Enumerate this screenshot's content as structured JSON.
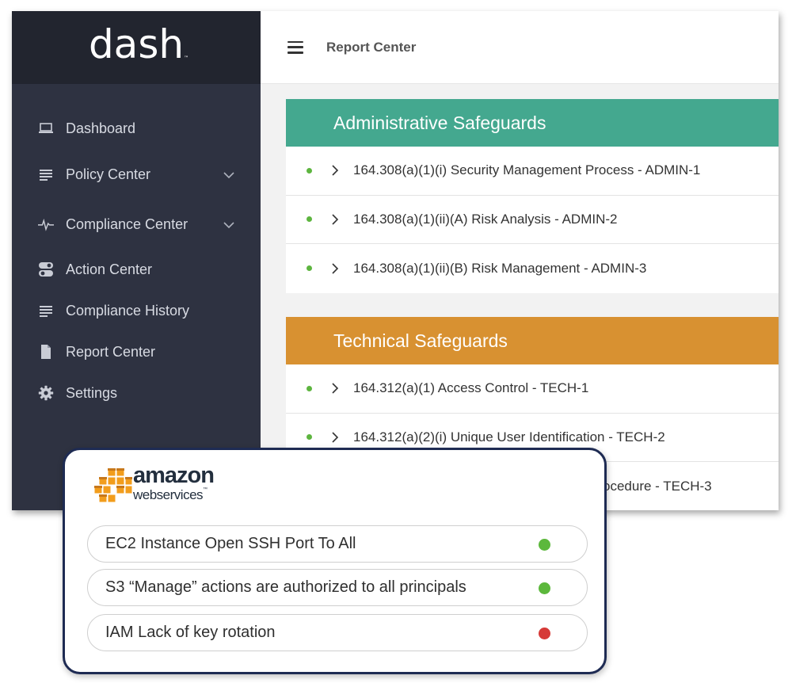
{
  "app": {
    "logo": "dash",
    "logo_tm": "™"
  },
  "sidebar": {
    "items": [
      {
        "label": "Dashboard",
        "icon": "laptop-icon"
      },
      {
        "label": "Policy Center",
        "icon": "list-icon",
        "expandable": true
      },
      {
        "label": "Compliance Center",
        "icon": "pulse-icon",
        "expandable": true
      },
      {
        "label": "Action Center",
        "icon": "toggle-icon"
      },
      {
        "label": "Compliance History",
        "icon": "list-icon"
      },
      {
        "label": "Report Center",
        "icon": "document-icon"
      },
      {
        "label": "Settings",
        "icon": "gear-icon"
      }
    ]
  },
  "header": {
    "title": "Report Center"
  },
  "sections": [
    {
      "title": "Administrative Safeguards",
      "color": "#44a88f",
      "rows": [
        "164.308(a)(1)(i) Security Management Process - ADMIN-1",
        "164.308(a)(1)(ii)(A) Risk Analysis - ADMIN-2",
        "164.308(a)(1)(ii)(B) Risk Management - ADMIN-3"
      ]
    },
    {
      "title": "Technical Safeguards",
      "color": "#d89131",
      "rows": [
        "164.312(a)(1) Access Control - TECH-1",
        "164.312(a)(2)(i) Unique User Identification - TECH-2",
        "ocedure - TECH-3"
      ]
    }
  ],
  "aws": {
    "logo_word": "amazon",
    "logo_sub": "webservices",
    "logo_tm": "™",
    "checks": [
      {
        "label": "EC2 Instance Open SSH Port To All",
        "status_color": "#5cb83c"
      },
      {
        "label": "S3 “Manage” actions are authorized to all principals",
        "status_color": "#5cb83c"
      },
      {
        "label": "IAM Lack of key rotation",
        "status_color": "#d63a37"
      }
    ]
  },
  "colors": {
    "sidebar_bg": "#2e3241",
    "logo_bg": "#22252f",
    "status_green": "#5db53f",
    "card_border": "#1e2b53"
  }
}
